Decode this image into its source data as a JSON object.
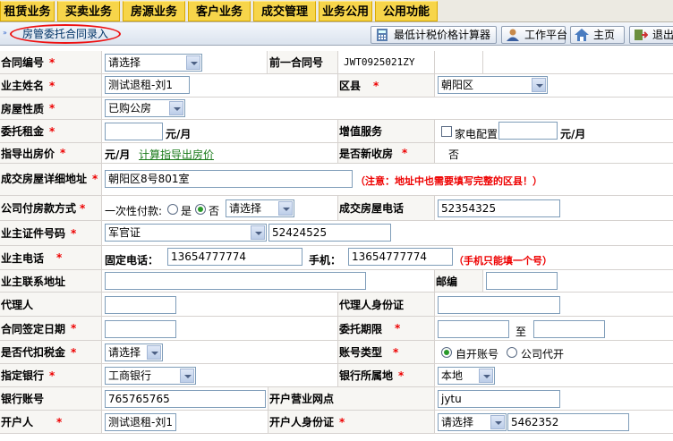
{
  "menu": [
    "租赁业务",
    "买卖业务",
    "房源业务",
    "客户业务",
    "成交管理",
    "业务公用",
    "公用功能"
  ],
  "breadcrumb": "房管委托合同录入",
  "toolbar": {
    "calculator": "最低计税价格计算器",
    "workbench": "工作平台",
    "home": "主页",
    "exit": "退出"
  },
  "form": {
    "contract_no": {
      "label": "合同编号",
      "value": "请选择"
    },
    "prev_contract_no": {
      "label": "前一合同号",
      "value": "JWT0925021ZY"
    },
    "owner_name": {
      "label": "业主姓名",
      "value": "测试退租-刘1"
    },
    "district": {
      "label": "区县",
      "value": "朝阳区"
    },
    "property_type": {
      "label": "房屋性质",
      "value": "已购公房"
    },
    "rent": {
      "label": "委托租金",
      "value": "",
      "unit": "元/月"
    },
    "value_added": {
      "label": "增值服务",
      "option": "家电配置",
      "value": "",
      "unit": "元/月"
    },
    "guide_price": {
      "label": "指导出房价",
      "unit": "元/月",
      "link": "计算指导出房价"
    },
    "new_property": {
      "label": "是否新收房",
      "value": "否"
    },
    "address": {
      "label": "成交房屋详细地址",
      "value": "朝阳区8号801室",
      "note": "（注意：地址中也需要填写完整的区县！）"
    },
    "payment": {
      "label": "公司付房款方式",
      "lump": "一次性付款:",
      "yes": "是",
      "no": "否",
      "select": "请选择"
    },
    "house_phone": {
      "label": "成交房屋电话",
      "value": "52354325"
    },
    "owner_id": {
      "label": "业主证件号码",
      "type": "军官证",
      "value": "52424525"
    },
    "owner_phone": {
      "label": "业主电话",
      "fixed_label": "固定电话：",
      "fixed": "13654777774",
      "mobile_label": "手机：",
      "mobile": "13654777774",
      "note": "（手机只能填一个号）"
    },
    "owner_address": {
      "label": "业主联系地址",
      "value": ""
    },
    "postcode": {
      "label": "邮编",
      "value": ""
    },
    "agent": {
      "label": "代理人",
      "value": ""
    },
    "agent_id": {
      "label": "代理人身份证",
      "value": ""
    },
    "sign_date": {
      "label": "合同签定日期",
      "value": ""
    },
    "period": {
      "label": "委托期限",
      "to": "至",
      "from_value": "",
      "to_value": ""
    },
    "withhold_tax": {
      "label": "是否代扣税金",
      "value": "请选择"
    },
    "account_type": {
      "label": "账号类型",
      "own": "自开账号",
      "company": "公司代开"
    },
    "bank": {
      "label": "指定银行",
      "value": "工商银行"
    },
    "bank_location": {
      "label": "银行所属地",
      "value": "本地"
    },
    "account_no": {
      "label": "银行账号",
      "value": "765765765"
    },
    "branch": {
      "label": "开户营业网点",
      "value": "jytu"
    },
    "account_holder": {
      "label": "开户人",
      "value": "测试退租-刘1"
    },
    "holder_id": {
      "label": "开户人身份证",
      "type": "请选择",
      "value": "5462352"
    }
  }
}
